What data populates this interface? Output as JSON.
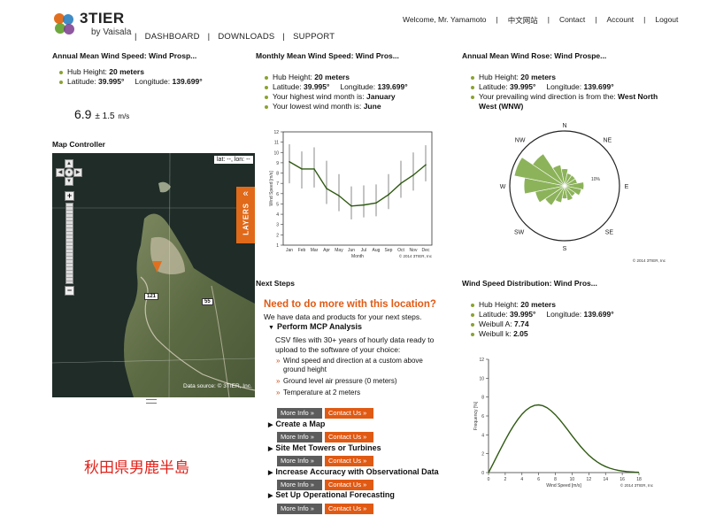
{
  "header": {
    "brand": "3TIER",
    "brand_sub": "by Vaisala",
    "nav": [
      "DASHBOARD",
      "DOWNLOADS",
      "SUPPORT"
    ],
    "top_nav": [
      "Welcome, Mr. Yamamoto",
      "中文网站",
      "Contact",
      "Account",
      "Logout"
    ]
  },
  "annual_speed": {
    "title": "Annual Mean Wind Speed: Wind Prosp...",
    "hub_label": "Hub Height:",
    "hub_value": "20 meters",
    "lat_label": "Latitude:",
    "lat_value": "39.995°",
    "lng_label": "Longitude:",
    "lng_value": "139.699°",
    "speed_value": "6.9",
    "speed_pm": "± 1.5",
    "speed_unit": "m/s"
  },
  "monthly": {
    "title": "Monthly Mean Wind Speed: Wind Pros...",
    "hub_label": "Hub Height:",
    "hub_value": "20 meters",
    "lat_label": "Latitude:",
    "lat_value": "39.995°",
    "lng_label": "Longitude:",
    "lng_value": "139.699°",
    "highest_label": "Your highest wind month is:",
    "highest_value": "January",
    "lowest_label": "Your lowest wind month is:",
    "lowest_value": "June",
    "copyright": "© 2014 3TIER, Inc"
  },
  "rose": {
    "title": "Annual Mean Wind Rose: Wind Prospe...",
    "hub_label": "Hub Height:",
    "hub_value": "20 meters",
    "lat_label": "Latitude:",
    "lat_value": "39.995°",
    "lng_label": "Longitude:",
    "lng_value": "139.699°",
    "prevailing_label": "Your prevailing wind direction is from the:",
    "prevailing_value": "West North West (WNW)",
    "copyright": "© 2014 3TIER, Inc"
  },
  "map": {
    "title": "Map Controller",
    "coords": "lat: --, lon: --",
    "layers": "LAYERS",
    "layers_chevron": "«",
    "attribution": "Data source: © 3TIER, Inc.",
    "route_a": "121",
    "route_b": "55"
  },
  "next_steps": {
    "title": "Next Steps",
    "heading": "Need to do more with this location?",
    "intro": "We have data and products for your next steps.",
    "perform": "Perform MCP Analysis",
    "csv_text": "CSV files with 30+ years of hourly data ready to upload to the software of your choice:",
    "options": [
      "Wind speed and direction at a custom above ground height",
      "Ground level air pressure (0 meters)",
      "Temperature at 2 meters"
    ],
    "more_info": "More Info »",
    "contact_us": "Contact Us »",
    "items": [
      "Create a Map",
      "Site Met Towers or Turbines",
      "Increase Accuracy with Observational Data",
      "Set Up Operational Forecasting"
    ]
  },
  "distribution": {
    "title": "Wind Speed Distribution: Wind Pros...",
    "hub_label": "Hub Height:",
    "hub_value": "20 meters",
    "lat_label": "Latitude:",
    "lat_value": "39.995°",
    "lng_label": "Longitude:",
    "lng_value": "139.699°",
    "weibull_a_label": "Weibull A:",
    "weibull_a_value": "7.74",
    "weibull_k_label": "Weibull k:",
    "weibull_k_value": "2.05",
    "copyright": "© 2014 3TIER, Inc"
  },
  "note": "秋田県男鹿半島",
  "colors": {
    "accent": "#e05a14",
    "series": "#2f5a12",
    "rose_fill": "#8cb35a",
    "bullet": "#8aa232"
  },
  "chart_data": [
    {
      "type": "line",
      "categories": [
        "Jan",
        "Feb",
        "Mar",
        "Apr",
        "May",
        "Jun",
        "Jul",
        "Aug",
        "Sep",
        "Oct",
        "Nov",
        "Dec"
      ],
      "values": [
        9.1,
        8.4,
        8.4,
        6.5,
        5.8,
        4.8,
        4.9,
        5.1,
        5.9,
        7.0,
        7.8,
        8.8
      ],
      "low": [
        7.0,
        6.5,
        6.6,
        5.0,
        4.3,
        3.5,
        3.7,
        3.8,
        4.5,
        5.6,
        6.3,
        7.2
      ],
      "high": [
        10.8,
        10.1,
        10.5,
        9.2,
        7.9,
        6.7,
        6.8,
        6.9,
        7.9,
        9.2,
        10.0,
        10.7
      ],
      "xlabel": "Month",
      "ylabel": "Wind Speed [m/s]",
      "ylim": [
        1,
        12
      ],
      "yticks": [
        1,
        2,
        3,
        4,
        5,
        6,
        7,
        8,
        9,
        10,
        11,
        12
      ]
    },
    {
      "type": "wind-rose",
      "directions": [
        "N",
        "NNE",
        "NE",
        "ENE",
        "E",
        "ESE",
        "SE",
        "SSE",
        "S",
        "SSW",
        "SW",
        "WSW",
        "W",
        "WNW",
        "NW",
        "NNW"
      ],
      "values": [
        4.0,
        3.0,
        3.0,
        3.0,
        4.5,
        4.0,
        3.0,
        3.5,
        3.0,
        4.0,
        5.5,
        7.0,
        9.5,
        12.0,
        9.0,
        5.0
      ],
      "compass": [
        "N",
        "NE",
        "E",
        "SE",
        "S",
        "SW",
        "W",
        "NW"
      ],
      "ring_label": "10%"
    },
    {
      "type": "line",
      "x": [
        0,
        0.5,
        1,
        1.5,
        2,
        2.5,
        3,
        3.5,
        4,
        4.5,
        5,
        5.5,
        6,
        6.5,
        7,
        7.5,
        8,
        8.5,
        9,
        9.5,
        10,
        10.5,
        11,
        11.5,
        12,
        12.5,
        13,
        13.5,
        14,
        14.5,
        15,
        15.5,
        16,
        16.5,
        17,
        17.5,
        18
      ],
      "values": [
        0.0,
        0.85,
        1.73,
        2.6,
        3.44,
        4.24,
        4.97,
        5.62,
        6.18,
        6.62,
        6.93,
        7.12,
        7.17,
        7.08,
        6.87,
        6.54,
        6.12,
        5.62,
        5.07,
        4.49,
        3.9,
        3.33,
        2.79,
        2.29,
        1.84,
        1.46,
        1.13,
        0.86,
        0.64,
        0.47,
        0.34,
        0.24,
        0.17,
        0.11,
        0.08,
        0.05,
        0.03
      ],
      "xlabel": "Wind Speed [m/s]",
      "ylabel": "Frequency [%]",
      "xlim": [
        0,
        18
      ],
      "ylim": [
        0,
        12
      ],
      "xticks": [
        0,
        2,
        4,
        6,
        8,
        10,
        12,
        14,
        16,
        18
      ],
      "yticks": [
        0,
        2,
        4,
        6,
        8,
        10,
        12
      ]
    }
  ]
}
